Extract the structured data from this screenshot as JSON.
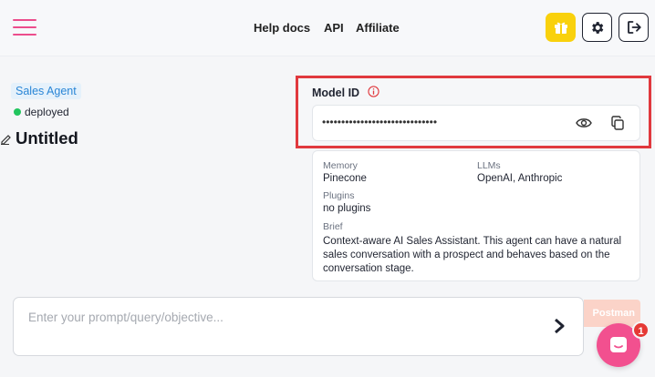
{
  "header": {
    "nav": [
      {
        "label": "Help docs"
      },
      {
        "label": "API"
      },
      {
        "label": "Affiliate"
      }
    ],
    "icons": [
      "menu-icon",
      "gift-icon",
      "gear-icon",
      "logout-icon"
    ],
    "colors": {
      "menu": "#ec4d8c",
      "gift_bg": "#f9d10c"
    }
  },
  "agent": {
    "type_badge": "Sales Agent",
    "status": "deployed",
    "status_color": "#22c55e",
    "title": "Untitled"
  },
  "model": {
    "label": "Model ID",
    "masked_value": "••••••••••••••••••••••••••••••",
    "highlight_color": "#e0393e"
  },
  "details": {
    "memory_label": "Memory",
    "memory_value": "Pinecone",
    "llms_label": "LLMs",
    "llms_value": "OpenAI, Anthropic",
    "plugins_label": "Plugins",
    "plugins_value": "no plugins",
    "brief_label": "Brief",
    "brief_value": "Context-aware AI Sales Assistant. This agent can have a natural sales conversation with a prospect and behaves based on the conversation stage."
  },
  "prompt": {
    "placeholder": "Enter your prompt/query/objective..."
  },
  "postman": {
    "label": "Postman"
  },
  "chat": {
    "badge_count": "1"
  }
}
